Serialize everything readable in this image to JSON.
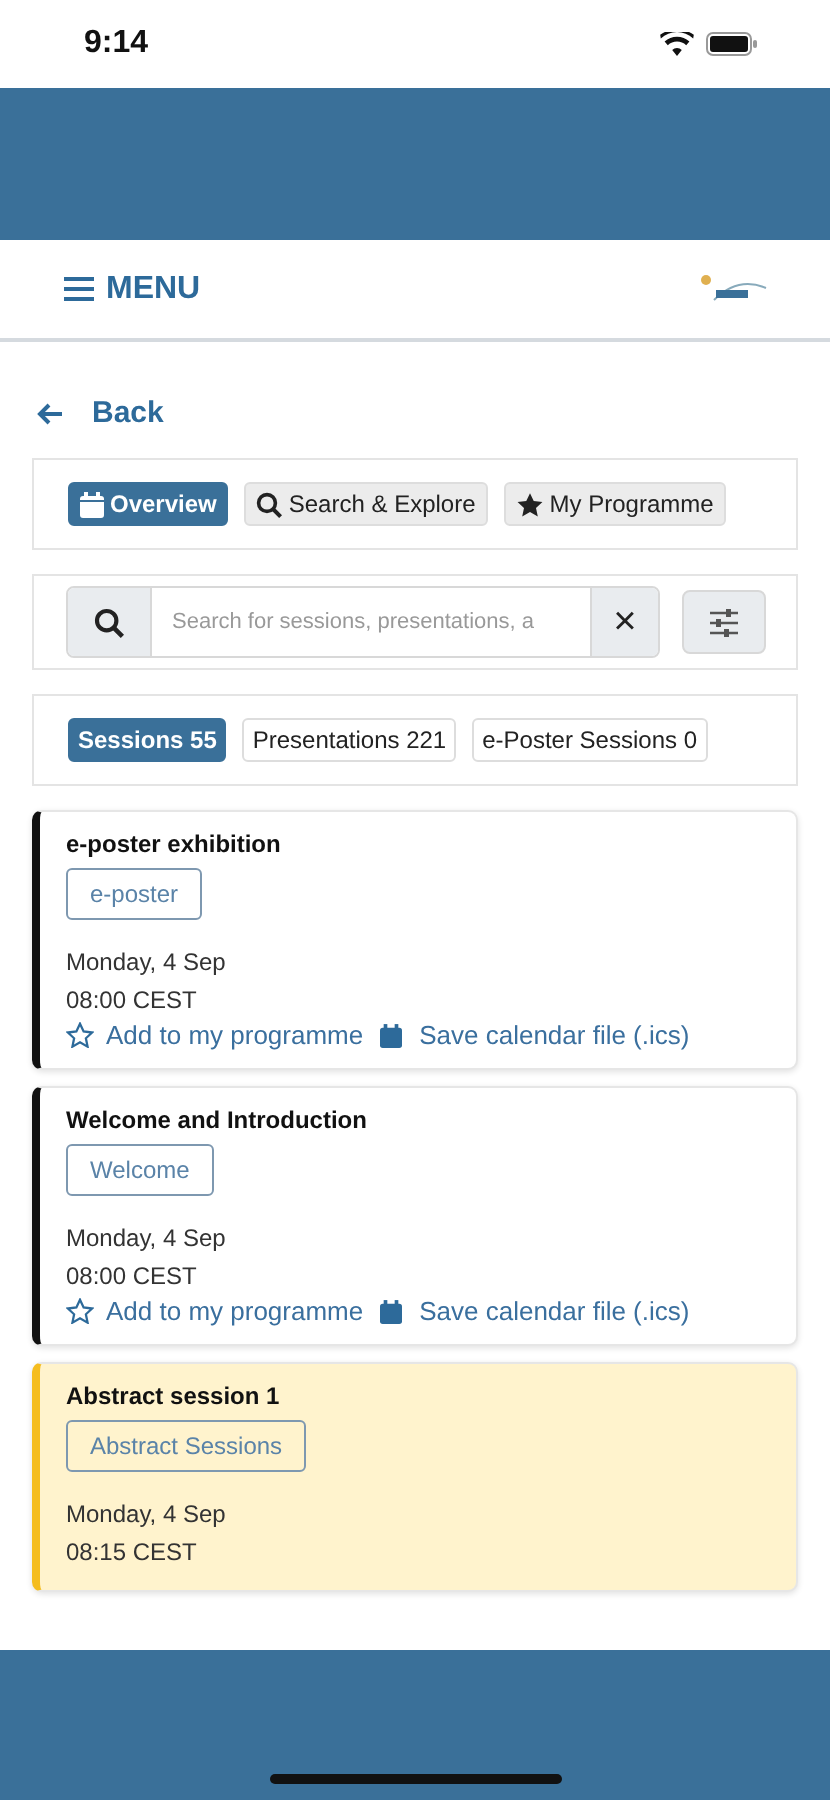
{
  "status_bar": {
    "time": "9:14"
  },
  "nav": {
    "menu_label": "MENU"
  },
  "back": {
    "label": "Back"
  },
  "tabs": [
    {
      "label": "Overview",
      "kind": "calendar",
      "selected": true
    },
    {
      "label": "Search & Explore",
      "kind": "search",
      "selected": false
    },
    {
      "label": "My Programme",
      "kind": "star",
      "selected": false
    }
  ],
  "search": {
    "placeholder": "Search for sessions, presentations, a",
    "clear": "×"
  },
  "counters": [
    {
      "label": "Sessions 55",
      "selected": true
    },
    {
      "label": "Presentations 221",
      "selected": false
    },
    {
      "label": "e-Poster Sessions 0",
      "selected": false
    }
  ],
  "sessions": [
    {
      "title": "e-poster exhibition",
      "tag": "e-poster",
      "date": "Monday, 4 Sep",
      "time": "08:00 CEST",
      "color": "#111111",
      "highlighted": false,
      "actions": [
        "Add to my programme",
        "Save calendar file (.ics)"
      ]
    },
    {
      "title": "Welcome and Introduction",
      "tag": "Welcome",
      "date": "Monday, 4 Sep",
      "time": "08:00 CEST",
      "color": "#111111",
      "highlighted": false,
      "actions": [
        "Add to my programme",
        "Save calendar file (.ics)"
      ]
    },
    {
      "title": "Abstract session 1",
      "tag": "Abstract Sessions",
      "date": "Monday, 4 Sep",
      "time": "08:15 CEST",
      "color": "#f5bd1f",
      "highlighted": true
    }
  ]
}
